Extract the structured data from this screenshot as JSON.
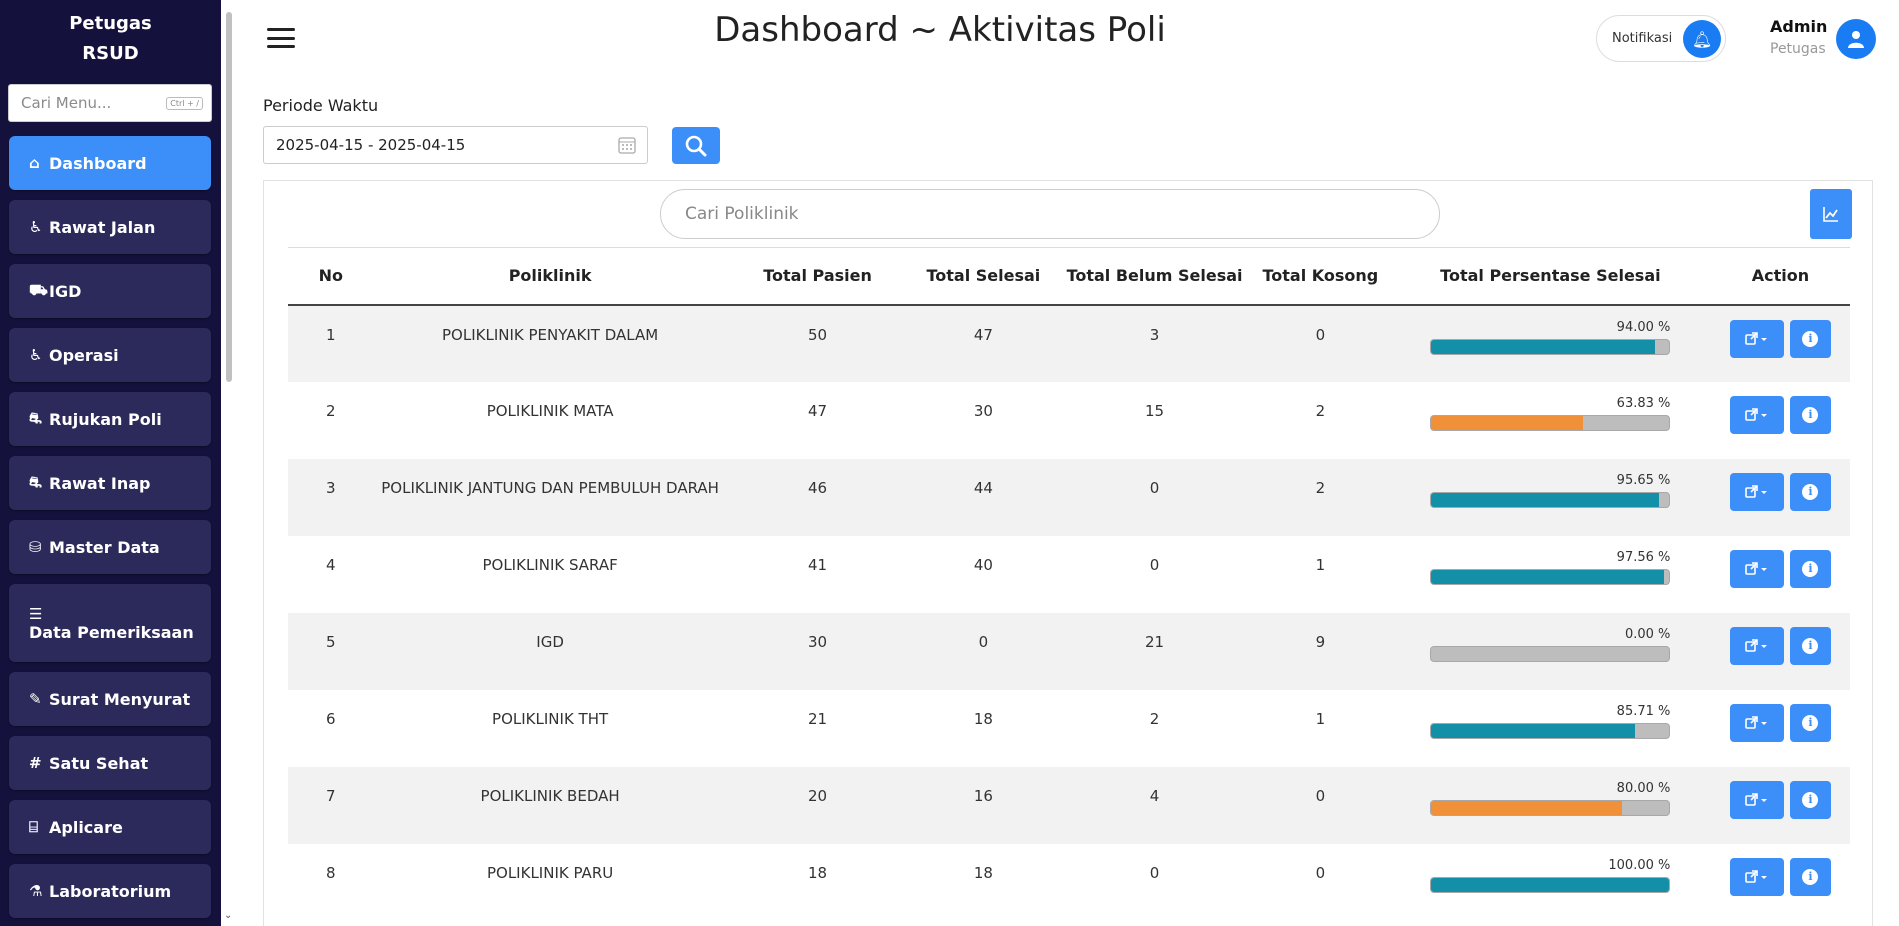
{
  "sidebar": {
    "brand_line1": "Petugas",
    "brand_line2": "RSUD",
    "search_placeholder": "Cari Menu...",
    "search_shortcut": "Ctrl + /",
    "items": [
      {
        "label": "Dashboard",
        "icon": "home-icon",
        "glyph": "⌂"
      },
      {
        "label": "Rawat Jalan",
        "icon": "patient-icon",
        "glyph": "♿"
      },
      {
        "label": "IGD",
        "icon": "ambulance-icon",
        "glyph": "⛟"
      },
      {
        "label": "Operasi",
        "icon": "surgery-icon",
        "glyph": "♿"
      },
      {
        "label": "Rujukan Poli",
        "icon": "bed-icon",
        "glyph": "⛐"
      },
      {
        "label": "Rawat Inap",
        "icon": "hospital-bed-icon",
        "glyph": "⛐"
      },
      {
        "label": "Master Data",
        "icon": "database-icon",
        "glyph": "⛁"
      },
      {
        "label": "Data Pemeriksaan",
        "icon": "list-icon",
        "glyph": "☰"
      },
      {
        "label": "Surat Menyurat",
        "icon": "edit-icon",
        "glyph": "✎"
      },
      {
        "label": "Satu Sehat",
        "icon": "hash-icon",
        "glyph": "#"
      },
      {
        "label": "Aplicare",
        "icon": "building-icon",
        "glyph": "⌸"
      },
      {
        "label": "Laboratorium",
        "icon": "flask-icon",
        "glyph": "⚗"
      }
    ]
  },
  "header": {
    "title": "Dashboard ~ Aktivitas Poli",
    "notif_label": "Notifikasi",
    "user_name": "Admin",
    "user_role": "Petugas"
  },
  "filter": {
    "label": "Periode Waktu",
    "date_range": "2025-04-15 - 2025-04-15"
  },
  "poli_search_placeholder": "Cari Poliklinik",
  "table": {
    "columns": [
      "No",
      "Poliklinik",
      "Total Pasien",
      "Total Selesai",
      "Total Belum Selesai",
      "Total Kosong",
      "Total Persentase Selesai",
      "Action"
    ],
    "rows": [
      {
        "no": "1",
        "poli": "POLIKLINIK PENYAKIT DALAM",
        "pasien": "50",
        "selesai": "47",
        "belum": "3",
        "kosong": "0",
        "pct_label": "94.00 %",
        "pct": 94.0,
        "color": "#138fa8"
      },
      {
        "no": "2",
        "poli": "POLIKLINIK MATA",
        "pasien": "47",
        "selesai": "30",
        "belum": "15",
        "kosong": "2",
        "pct_label": "63.83 %",
        "pct": 63.83,
        "color": "#f0913a"
      },
      {
        "no": "3",
        "poli": "POLIKLINIK JANTUNG DAN PEMBULUH DARAH",
        "pasien": "46",
        "selesai": "44",
        "belum": "0",
        "kosong": "2",
        "pct_label": "95.65 %",
        "pct": 95.65,
        "color": "#138fa8"
      },
      {
        "no": "4",
        "poli": "POLIKLINIK SARAF",
        "pasien": "41",
        "selesai": "40",
        "belum": "0",
        "kosong": "1",
        "pct_label": "97.56 %",
        "pct": 97.56,
        "color": "#138fa8"
      },
      {
        "no": "5",
        "poli": "IGD",
        "pasien": "30",
        "selesai": "0",
        "belum": "21",
        "kosong": "9",
        "pct_label": "0.00 %",
        "pct": 0,
        "color": "#138fa8"
      },
      {
        "no": "6",
        "poli": "POLIKLINIK THT",
        "pasien": "21",
        "selesai": "18",
        "belum": "2",
        "kosong": "1",
        "pct_label": "85.71 %",
        "pct": 85.71,
        "color": "#138fa8"
      },
      {
        "no": "7",
        "poli": "POLIKLINIK BEDAH",
        "pasien": "20",
        "selesai": "16",
        "belum": "4",
        "kosong": "0",
        "pct_label": "80.00 %",
        "pct": 80.0,
        "color": "#f0913a"
      },
      {
        "no": "8",
        "poli": "POLIKLINIK PARU",
        "pasien": "18",
        "selesai": "18",
        "belum": "0",
        "kosong": "0",
        "pct_label": "100.00 %",
        "pct": 100.0,
        "color": "#138fa8"
      }
    ]
  }
}
